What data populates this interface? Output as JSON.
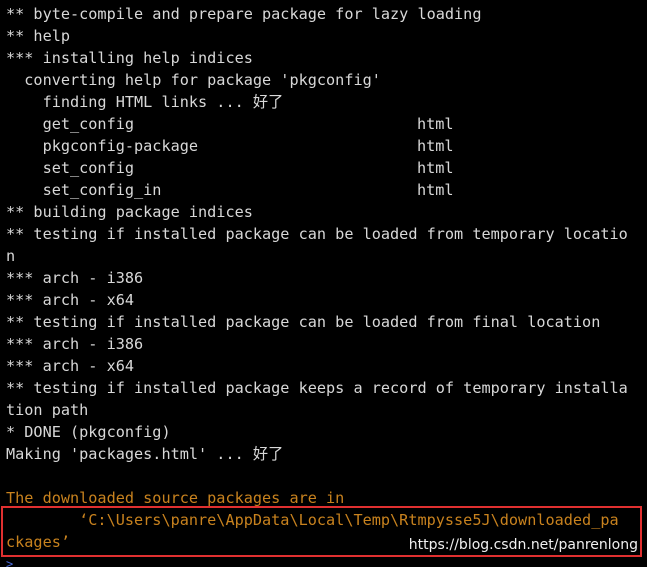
{
  "console": {
    "lines": [
      "** byte-compile and prepare package for lazy loading",
      "** help",
      "*** installing help indices",
      "  converting help for package 'pkgconfig'",
      "    finding HTML links ... 好了",
      "    get_config",
      "    pkgconfig-package",
      "    set_config",
      "    set_config_in",
      "** building package indices",
      "** testing if installed package can be loaded from temporary locatio",
      "n",
      "*** arch - i386",
      "*** arch - x64",
      "** testing if installed package can be loaded from final location",
      "*** arch - i386",
      "*** arch - x64",
      "** testing if installed package keeps a record of temporary installa",
      "tion path",
      "* DONE (pkgconfig)",
      "Making 'packages.html' ... 好了",
      "",
      "The downloaded source packages are in",
      "        ‘C:\\Users\\panre\\AppData\\Local\\Temp\\Rtmpysse5J\\downloaded_pa",
      "ckages’"
    ],
    "help_format": [
      "html",
      "html",
      "html",
      "html"
    ],
    "prompt_symbol": ">"
  },
  "watermark": "https://blog.csdn.net/panrenlong",
  "colors": {
    "background": "#000000",
    "text": "#d8d8d8",
    "warning_text": "#c8821e",
    "highlight_border": "#e03030",
    "prompt": "#4a6ad8"
  }
}
